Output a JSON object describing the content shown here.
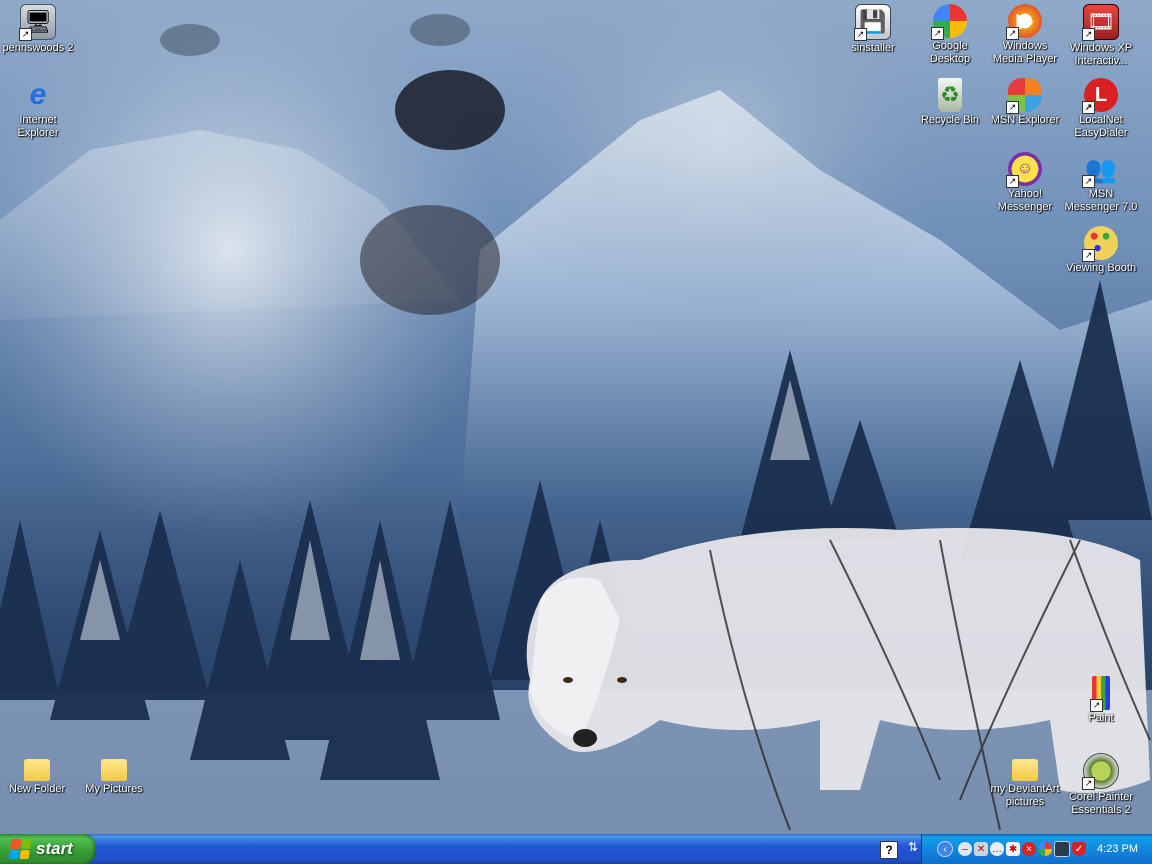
{
  "desktop": {
    "icons_left": [
      {
        "label": "pennswoods 2",
        "icon": "network-computer-icon"
      },
      {
        "label": "Internet Explorer",
        "icon": "internet-explorer-icon"
      },
      {
        "label": "New Folder",
        "icon": "folder-icon"
      },
      {
        "label": "My Pictures",
        "icon": "folder-icon"
      }
    ],
    "icons_right": [
      {
        "label": "sinstaller",
        "icon": "installer-icon"
      },
      {
        "label": "Google Desktop",
        "icon": "google-desktop-icon"
      },
      {
        "label": "Windows Media Player",
        "icon": "media-player-icon"
      },
      {
        "label": "Windows XP Interactiv...",
        "icon": "film-icon"
      },
      {
        "label": "Recycle Bin",
        "icon": "recycle-bin-icon"
      },
      {
        "label": "MSN Explorer",
        "icon": "msn-butterfly-icon"
      },
      {
        "label": "LocalNet EasyDialer",
        "icon": "localnet-icon"
      },
      {
        "label": "Yahoo! Messenger",
        "icon": "yahoo-messenger-icon"
      },
      {
        "label": "MSN Messenger 7.0",
        "icon": "msn-messenger-icon"
      },
      {
        "label": "Viewing Booth",
        "icon": "palette-icon"
      },
      {
        "label": "Paint",
        "icon": "paint-icon"
      },
      {
        "label": "my DeviantArt pictures",
        "icon": "folder-icon"
      },
      {
        "label": "Corel Painter Essentials 2",
        "icon": "corel-painter-icon"
      }
    ]
  },
  "taskbar": {
    "start_label": "start",
    "clock": "4:23 PM",
    "quick_help": "?",
    "tray_icons": [
      "chevron-left-icon",
      "minus-circle-icon",
      "network-x-icon",
      "speech-bubble-icon",
      "antivirus-icon",
      "no-entry-icon",
      "google-icon",
      "monitor-icon",
      "shield-icon"
    ]
  },
  "colors": {
    "taskbar_blue": "#245edb",
    "start_green": "#3c9b3c",
    "tray_blue": "#1287de",
    "label_text": "#ffffff"
  }
}
